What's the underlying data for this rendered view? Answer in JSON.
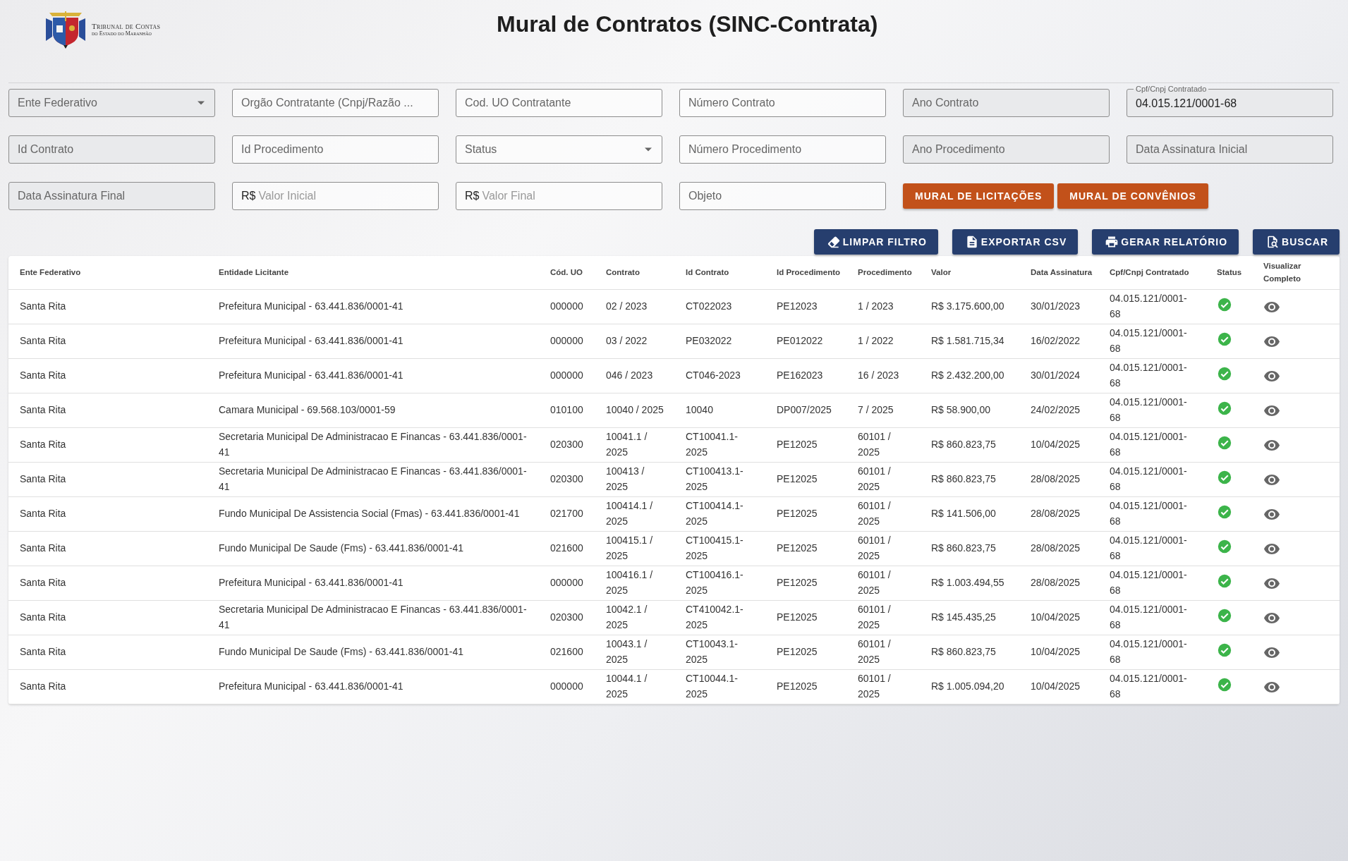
{
  "header": {
    "org_line1": "Tribunal de Contas",
    "org_line2": "do Estado do Maranhão",
    "title": "Mural de Contratos (SINC-Contrata)"
  },
  "filters": [
    {
      "kind": "select",
      "label": "Ente Federativo",
      "disabled": true
    },
    {
      "kind": "text",
      "label": "Orgão Contratante (Cnpj/Razão ...",
      "disabled": false
    },
    {
      "kind": "text",
      "label": "Cod. UO Contratante",
      "disabled": false
    },
    {
      "kind": "text",
      "label": "Número Contrato",
      "disabled": false
    },
    {
      "kind": "text",
      "label": "Ano Contrato",
      "disabled": true
    },
    {
      "kind": "filled",
      "label": "Cpf/Cnpj Contratado",
      "value": "04.015.121/0001-68",
      "disabled": true
    },
    {
      "kind": "text",
      "label": "Id Contrato",
      "disabled": true
    },
    {
      "kind": "text",
      "label": "Id Procedimento",
      "disabled": false
    },
    {
      "kind": "select",
      "label": "Status",
      "disabled": false
    },
    {
      "kind": "text",
      "label": "Número Procedimento",
      "disabled": false
    },
    {
      "kind": "text",
      "label": "Ano Procedimento",
      "disabled": true
    },
    {
      "kind": "text",
      "label": "Data Assinatura Inicial",
      "disabled": true
    },
    {
      "kind": "text",
      "label": "Data Assinatura Final",
      "disabled": true
    },
    {
      "kind": "money",
      "prefix": "R$",
      "placeholder": "Valor Inicial",
      "disabled": false
    },
    {
      "kind": "money",
      "prefix": "R$",
      "placeholder": "Valor Final",
      "disabled": false
    },
    {
      "kind": "text",
      "label": "Objeto",
      "disabled": false
    }
  ],
  "link_buttons": [
    "MURAL DE LICITAÇÕES",
    "MURAL DE CONVÊNIOS"
  ],
  "actions": [
    {
      "kind": "eraser",
      "label": "LIMPAR FILTRO"
    },
    {
      "kind": "file",
      "label": "EXPORTAR CSV"
    },
    {
      "kind": "printer",
      "label": "GERAR RELATÓRIO"
    },
    {
      "kind": "search",
      "label": "BUSCAR"
    }
  ],
  "table": {
    "columns": [
      "Ente Federativo",
      "Entidade Licitante",
      "Cód. UO",
      "Contrato",
      "Id Contrato",
      "Id Procedimento",
      "Procedimento",
      "Valor",
      "Data Assinatura",
      "Cpf/Cnpj Contratado",
      "Status",
      "Visualizar Completo"
    ],
    "rows": [
      {
        "cells": [
          "Santa Rita",
          "Prefeitura Municipal - 63.441.836/0001-41",
          "000000",
          "02 / 2023",
          "CT022023",
          "PE12023",
          "1 / 2023",
          "R$ 3.175.600,00",
          "30/01/2023",
          "04.015.121/0001-68"
        ],
        "approved": true
      },
      {
        "cells": [
          "Santa Rita",
          "Prefeitura Municipal - 63.441.836/0001-41",
          "000000",
          "03 / 2022",
          "PE032022",
          "PE012022",
          "1 / 2022",
          "R$ 1.581.715,34",
          "16/02/2022",
          "04.015.121/0001-68"
        ],
        "approved": true
      },
      {
        "cells": [
          "Santa Rita",
          "Prefeitura Municipal - 63.441.836/0001-41",
          "000000",
          "046 / 2023",
          "CT046-2023",
          "PE162023",
          "16 / 2023",
          "R$ 2.432.200,00",
          "30/01/2024",
          "04.015.121/0001-68"
        ],
        "approved": true
      },
      {
        "cells": [
          "Santa Rita",
          "Camara Municipal - 69.568.103/0001-59",
          "010100",
          "10040 / 2025",
          "10040",
          "DP007/2025",
          "7 / 2025",
          "R$ 58.900,00",
          "24/02/2025",
          "04.015.121/0001-68"
        ],
        "approved": true
      },
      {
        "cells": [
          "Santa Rita",
          "Secretaria Municipal De Administracao E Financas - 63.441.836/0001-41",
          "020300",
          "10041.1 / 2025",
          "CT10041.1-2025",
          "PE12025",
          "60101 / 2025",
          "R$ 860.823,75",
          "10/04/2025",
          "04.015.121/0001-68"
        ],
        "approved": true
      },
      {
        "cells": [
          "Santa Rita",
          "Secretaria Municipal De Administracao E Financas - 63.441.836/0001-41",
          "020300",
          "100413 / 2025",
          "CT100413.1-2025",
          "PE12025",
          "60101 / 2025",
          "R$ 860.823,75",
          "28/08/2025",
          "04.015.121/0001-68"
        ],
        "approved": true
      },
      {
        "cells": [
          "Santa Rita",
          "Fundo Municipal De Assistencia Social (Fmas) - 63.441.836/0001-41",
          "021700",
          "100414.1 / 2025",
          "CT100414.1-2025",
          "PE12025",
          "60101 / 2025",
          "R$ 141.506,00",
          "28/08/2025",
          "04.015.121/0001-68"
        ],
        "approved": true
      },
      {
        "cells": [
          "Santa Rita",
          "Fundo Municipal De Saude (Fms) - 63.441.836/0001-41",
          "021600",
          "100415.1 / 2025",
          "CT100415.1-2025",
          "PE12025",
          "60101 / 2025",
          "R$ 860.823,75",
          "28/08/2025",
          "04.015.121/0001-68"
        ],
        "approved": true
      },
      {
        "cells": [
          "Santa Rita",
          "Prefeitura Municipal - 63.441.836/0001-41",
          "000000",
          "100416.1 / 2025",
          "CT100416.1-2025",
          "PE12025",
          "60101 / 2025",
          "R$ 1.003.494,55",
          "28/08/2025",
          "04.015.121/0001-68"
        ],
        "approved": true
      },
      {
        "cells": [
          "Santa Rita",
          "Secretaria Municipal De Administracao E Financas - 63.441.836/0001-41",
          "020300",
          "10042.1 / 2025",
          "CT410042.1-2025",
          "PE12025",
          "60101 / 2025",
          "R$ 145.435,25",
          "10/04/2025",
          "04.015.121/0001-68"
        ],
        "approved": true
      },
      {
        "cells": [
          "Santa Rita",
          "Fundo Municipal De Saude (Fms) - 63.441.836/0001-41",
          "021600",
          "10043.1 / 2025",
          "CT10043.1-2025",
          "PE12025",
          "60101 / 2025",
          "R$ 860.823,75",
          "10/04/2025",
          "04.015.121/0001-68"
        ],
        "approved": true
      },
      {
        "cells": [
          "Santa Rita",
          "Prefeitura Municipal - 63.441.836/0001-41",
          "000000",
          "10044.1 / 2025",
          "CT10044.1-2025",
          "PE12025",
          "60101 / 2025",
          "R$ 1.005.094,20",
          "10/04/2025",
          "04.015.121/0001-68"
        ],
        "approved": true
      }
    ]
  }
}
